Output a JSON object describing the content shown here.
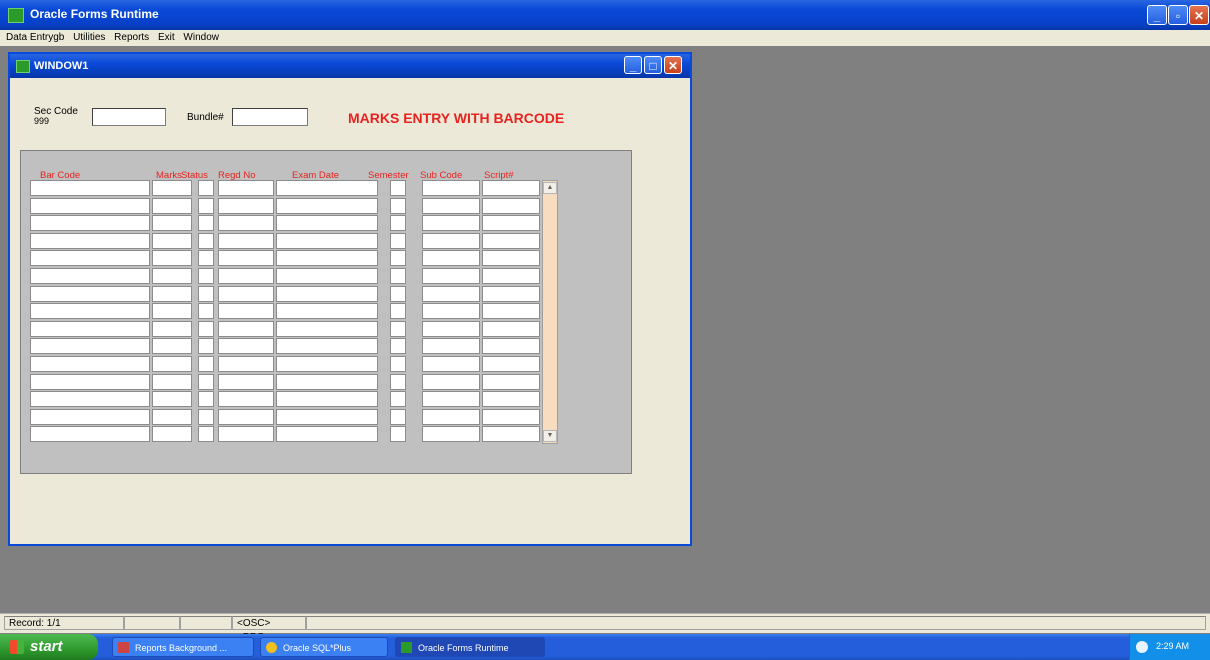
{
  "app": {
    "title": "Oracle Forms Runtime",
    "menu": [
      "Data Entrygb",
      "Utilities",
      "Reports",
      "Exit",
      "Window"
    ]
  },
  "window": {
    "title": "WINDOW1",
    "sec_code_label": "Sec Code",
    "sec_code_value": "999",
    "bundle_label": "Bundle#",
    "heading": "MARKS ENTRY WITH BARCODE",
    "columns": [
      "Bar Code",
      "Marks",
      "Status",
      "Regd No",
      "Exam Date",
      "Semester",
      "Sub Code",
      "Script#"
    ],
    "row_count": 15
  },
  "status_bar": {
    "record": "Record: 1/1",
    "mode": "<OSC> <DBG>"
  },
  "taskbar": {
    "start_label": "start",
    "items": [
      "Reports Background ...",
      "Oracle SQL*Plus",
      "Oracle Forms Runtime"
    ],
    "active_index": 2,
    "clock": "2:29 AM"
  },
  "colors": {
    "accent_red": "#e8231f",
    "titlebar_blue": "#0a4ad8",
    "form_bg": "#ece9d8"
  }
}
